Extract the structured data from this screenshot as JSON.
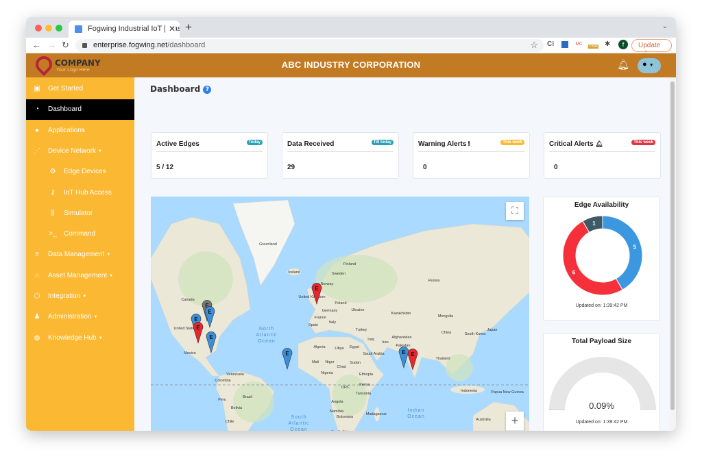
{
  "browser": {
    "tab_title": "Fogwing Industrial IoT | Dashboard",
    "url_host": "enterprise.fogwing.net",
    "url_path": "/dashboard",
    "update_label": "Update",
    "profile_initial": "f",
    "ext_badge": "<50k"
  },
  "header": {
    "logo_name": "COMPANY",
    "logo_tagline": "Your Logo Here",
    "title": "ABC INDUSTRY CORPORATION"
  },
  "sidebar": {
    "items": [
      {
        "label": "Get Started",
        "icon": "bus-icon"
      },
      {
        "label": "Dashboard",
        "icon": "gauge-icon",
        "active": true
      },
      {
        "label": "Applications",
        "icon": "app-icon"
      },
      {
        "label": "Device Network",
        "icon": "network-icon",
        "dropdown": true
      },
      {
        "label": "Edge Devices",
        "icon": "cogs-icon",
        "sub": true
      },
      {
        "label": "IoT Hub Access",
        "icon": "key-icon",
        "sub": true
      },
      {
        "label": "Simulator",
        "icon": "simulator-icon",
        "sub": true
      },
      {
        "label": "Command",
        "icon": "terminal-icon",
        "sub": true
      },
      {
        "label": "Data Management",
        "icon": "database-icon",
        "dropdown": true
      },
      {
        "label": "Asset Management",
        "icon": "bank-icon",
        "dropdown": true
      },
      {
        "label": "Integration",
        "icon": "integration-icon",
        "dropdown": true
      },
      {
        "label": "Administration",
        "icon": "user-cog-icon",
        "dropdown": true
      },
      {
        "label": "Knowledge Hub",
        "icon": "brain-icon",
        "dropdown": true
      }
    ]
  },
  "page": {
    "title": "Dashboard"
  },
  "cards": [
    {
      "title": "Active Edges",
      "badge": "Today",
      "badge_color": "#2a9fb5",
      "value": "5 / 12"
    },
    {
      "title": "Data Received",
      "badge": "Till today",
      "badge_color": "#2a9fb5",
      "value": "29"
    },
    {
      "title": "Warning Alerts",
      "icon": "exclamation-icon",
      "badge": "This week",
      "badge_color": "#fbb832",
      "value": "0"
    },
    {
      "title": "Critical Alerts",
      "icon": "bell-icon",
      "badge": "This week",
      "badge_color": "#dc3545",
      "value": "0"
    }
  ],
  "map": {
    "labels": [
      "Greenland",
      "Iceland",
      "Finland",
      "Sweden",
      "Norway",
      "Russia",
      "United Kingdom",
      "Poland",
      "Germany",
      "Ukraine",
      "France",
      "Italy",
      "Spain",
      "Kazakhstan",
      "Mongolia",
      "Japan",
      "China",
      "South Korea",
      "Turkey",
      "Iraq",
      "Iran",
      "Afghanistan",
      "Pakistan",
      "Canada",
      "United States",
      "Mexico",
      "Algeria",
      "Libya",
      "Egypt",
      "Saudi Arabia",
      "Thailand",
      "Mali",
      "Niger",
      "Sudan",
      "Chad",
      "Nigeria",
      "Ethiopia",
      "Venezuela",
      "Colombia",
      "Kenya",
      "DRC",
      "Tanzania",
      "Indonesia",
      "Papua New Guinea",
      "Brazil",
      "Peru",
      "Angola",
      "Bolivia",
      "Namibia",
      "Botswana",
      "Madagascar",
      "Chile",
      "South Africa",
      "Argentina",
      "Australia"
    ],
    "oceans": [
      "North Atlantic Ocean",
      "Indian Ocean",
      "South Atlantic Ocean"
    ],
    "marker_letter": "E",
    "markers": [
      {
        "status": "offline",
        "color": "#777777"
      },
      {
        "status": "active",
        "color": "#3b8fd8"
      },
      {
        "status": "active",
        "color": "#3b8fd8"
      },
      {
        "status": "critical",
        "color": "#e8262e"
      },
      {
        "status": "active",
        "color": "#3b8fd8"
      },
      {
        "status": "critical",
        "color": "#e8262e"
      },
      {
        "status": "active",
        "color": "#3b8fd8"
      },
      {
        "status": "active",
        "color": "#3b8fd8"
      },
      {
        "status": "critical",
        "color": "#e8262e"
      }
    ],
    "zoom_in": "+",
    "zoom_out": "−"
  },
  "edge_availability": {
    "title": "Edge Availability",
    "updated": "Updated on: 1:39:42 PM",
    "chart_data": {
      "type": "pie",
      "donut": true,
      "values": [
        5,
        6,
        1
      ],
      "colors": [
        "#3b97e0",
        "#f5303a",
        "#3d5a66"
      ]
    }
  },
  "payload": {
    "title": "Total Payload Size",
    "value_label": "0.09%",
    "value": 0.09,
    "updated": "Updated on: 1:39:42 PM"
  }
}
